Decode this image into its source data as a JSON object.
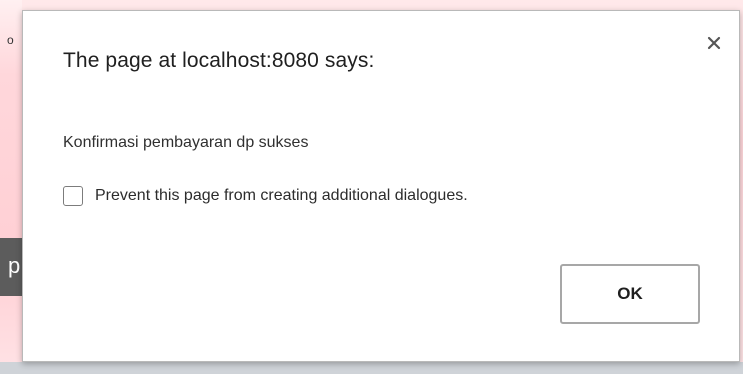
{
  "background": {
    "left_edge_text_top": "o",
    "left_edge_text_bottom": "p"
  },
  "dialog": {
    "title": "The page at localhost:8080 says:",
    "message": "Konfirmasi pembayaran dp sukses",
    "prevent_checkbox": {
      "label": "Prevent this page from creating additional dialogues.",
      "checked": false
    },
    "ok_label": "OK",
    "close_icon": "close-icon"
  }
}
